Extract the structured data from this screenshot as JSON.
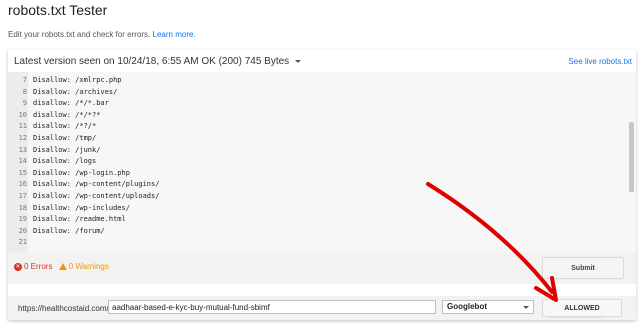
{
  "page": {
    "title": "robots.txt Tester",
    "subtitle": "Edit your robots.txt and check for errors.",
    "learn_more": "Learn more."
  },
  "version": {
    "label": "Latest version seen on 10/24/18, 6:55 AM OK (200) 745 Bytes",
    "live_link": "See live robots.txt"
  },
  "editor": {
    "lines": [
      {
        "num": "7",
        "text": "Disallow: /xmlrpc.php"
      },
      {
        "num": "8",
        "text": "Disallow: /archives/"
      },
      {
        "num": "9",
        "text": "disallow: /*/*.bar"
      },
      {
        "num": "10",
        "text": "disallow: /*/*?*"
      },
      {
        "num": "11",
        "text": "disallow: /*?/*"
      },
      {
        "num": "12",
        "text": "Disallow: /tmp/"
      },
      {
        "num": "13",
        "text": "Disallow: /junk/"
      },
      {
        "num": "14",
        "text": "Disallow: /logs"
      },
      {
        "num": "15",
        "text": "Disallow: /wp-login.php"
      },
      {
        "num": "16",
        "text": "Disallow: /wp-content/plugins/"
      },
      {
        "num": "17",
        "text": "Disallow: /wp-content/uploads/"
      },
      {
        "num": "18",
        "text": "Disallow: /wp-includes/"
      },
      {
        "num": "19",
        "text": "Disallow: /readme.html"
      },
      {
        "num": "20",
        "text": "Disallow: /forum/"
      },
      {
        "num": "21",
        "text": ""
      }
    ]
  },
  "status": {
    "errors": "0 Errors",
    "warnings": "0 Warnings",
    "submit_label": "Submit"
  },
  "test": {
    "url_prefix": "https://healthcostaid.com/",
    "path_value": "aadhaar-based-e-kyc-buy-mutual-fund-sbimf",
    "agent": "Googlebot",
    "result": "ALLOWED"
  },
  "colors": {
    "link": "#1a73e8",
    "error": "#d93025",
    "warning": "#f29900",
    "highlight": "#f5f53a",
    "annotation_arrow": "#e00000"
  }
}
